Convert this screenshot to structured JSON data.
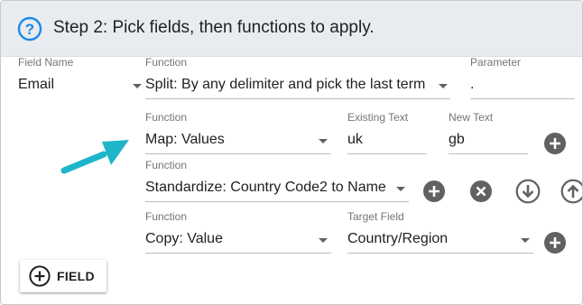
{
  "header": {
    "title": "Step 2: Pick fields, then functions to apply."
  },
  "row1": {
    "field_name_label": "Field Name",
    "field_name_value": "Email",
    "function_label": "Function",
    "function_value": "Split: By any delimiter and pick the last term",
    "parameter_label": "Parameter",
    "parameter_value": "."
  },
  "row2": {
    "function_label": "Function",
    "function_value": "Map: Values",
    "existing_text_label": "Existing Text",
    "existing_text_value": "uk",
    "new_text_label": "New Text",
    "new_text_value": "gb"
  },
  "row3": {
    "function_label": "Function",
    "function_value": "Standardize: Country Code2 to Name"
  },
  "row4": {
    "function_label": "Function",
    "function_value": "Copy: Value",
    "target_field_label": "Target Field",
    "target_field_value": "Country/Region"
  },
  "add_field_button": {
    "label": "FIELD"
  },
  "icons": {
    "help": "help-circle-icon",
    "add": "add-circle-icon",
    "remove": "close-circle-icon",
    "move_down": "arrow-down-circle-icon",
    "move_up": "arrow-up-circle-icon",
    "pointer_arrow": "callout-arrow-icon"
  },
  "colors": {
    "header_bg": "#e8ecf0",
    "accent_blue": "#1e88e5",
    "icon_grey": "#616161",
    "arrow_teal": "#1fb5c8"
  }
}
